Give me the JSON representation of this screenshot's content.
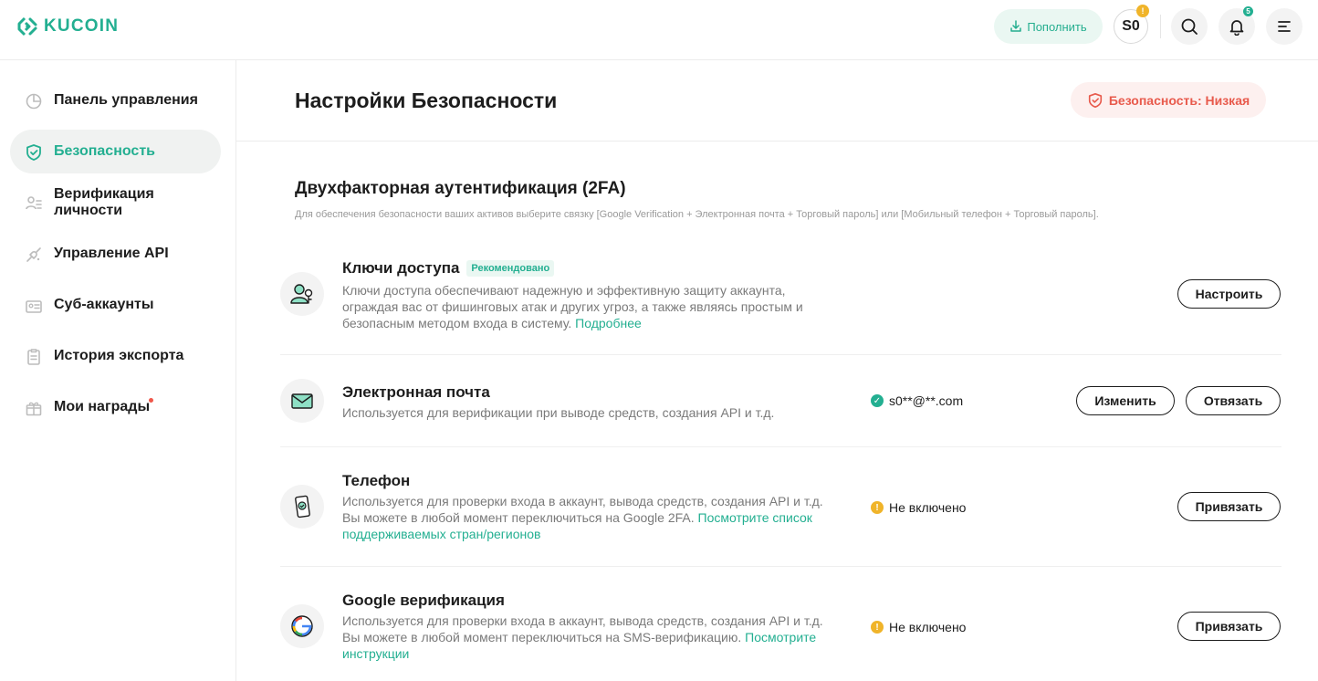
{
  "header": {
    "logo_text": "KUCOIN",
    "deposit_label": "Пополнить",
    "avatar_initials": "S0",
    "avatar_badge": "!",
    "notifications_count": "5"
  },
  "sidebar": {
    "items": [
      {
        "label": "Панель управления",
        "icon": "dashboard-icon"
      },
      {
        "label": "Безопасность",
        "icon": "shield-icon"
      },
      {
        "label": "Верификация личности",
        "icon": "id-verify-icon"
      },
      {
        "label": "Управление API",
        "icon": "api-icon"
      },
      {
        "label": "Суб-аккаунты",
        "icon": "sub-accounts-icon"
      },
      {
        "label": "История экспорта",
        "icon": "export-history-icon"
      },
      {
        "label": "Мои награды",
        "icon": "rewards-icon"
      }
    ]
  },
  "page": {
    "title": "Настройки Безопасности",
    "security_level": "Безопасность: Низкая"
  },
  "section": {
    "title": "Двухфакторная аутентификация (2FA)",
    "subtitle": "Для обеспечения безопасности ваших активов выберите связку [Google Verification + Электронная почта + Торговый пароль] или [Мобильный телефон + Торговый пароль]."
  },
  "rows": {
    "passkey": {
      "title": "Ключи доступа",
      "tag": "Рекомендовано",
      "desc": "Ключи доступа обеспечивают надежную и эффективную защиту аккаунта, ограждая вас от фишинговых атак и других угроз, а также являясь простым и безопасным методом входа в систему.",
      "link": "Подробнее",
      "button": "Настроить"
    },
    "email": {
      "title": "Электронная почта",
      "desc": "Используется для верификации при выводе средств, создания API и т.д.",
      "status": "s0**@**.com",
      "button_change": "Изменить",
      "button_unbind": "Отвязать"
    },
    "phone": {
      "title": "Телефон",
      "desc": "Используется для проверки входа в аккаунт, вывода средств, создания API и т.д. Вы можете в любой момент переключиться на Google 2FA.",
      "link": "Посмотрите список поддерживаемых стран/регионов",
      "status": "Не включено",
      "button": "Привязать"
    },
    "google": {
      "title": "Google верификация",
      "desc": "Используется для проверки входа в аккаунт, вывода средств, создания API и т.д. Вы можете в любой момент переключиться на SMS-верификацию.",
      "link": "Посмотрите инструкции",
      "status": "Не включено",
      "button": "Привязать"
    }
  },
  "colors": {
    "brand": "#23af91",
    "danger": "#e85a4c",
    "warning": "#f0b42a"
  }
}
